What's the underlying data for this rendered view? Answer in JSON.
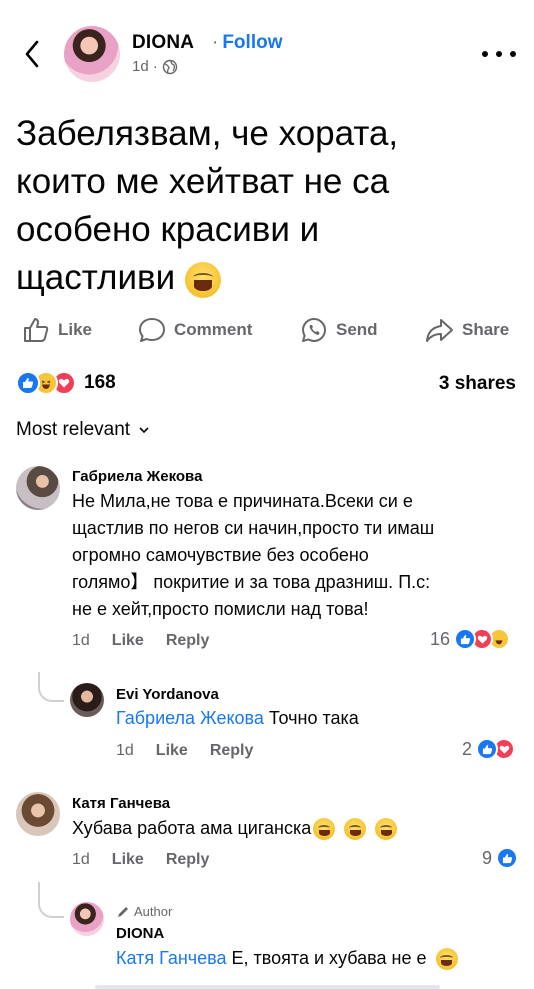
{
  "header": {
    "author": "DIONA",
    "separator": "·",
    "follow": "Follow",
    "time": "1d",
    "privacy_icon": "globe-icon"
  },
  "post": {
    "text_lines": [
      "Забелязвам, че хората,",
      "които ме хейтват не са",
      "особено красиви и",
      "щастливи"
    ],
    "emoji": "grinning-squinting-face"
  },
  "actions": {
    "like": "Like",
    "comment": "Comment",
    "send": "Send",
    "share": "Share"
  },
  "reactions": {
    "count": "168",
    "types": [
      "like",
      "haha",
      "love"
    ],
    "shares": "3 shares"
  },
  "sort": {
    "label": "Most relevant"
  },
  "comments": [
    {
      "name": "Габриела Жекова",
      "lines": [
        "Не Мила,не това е причината.Всеки си е",
        "щастлив по негов си начин,просто ти имаш",
        "огромно самочувствие без особено",
        "голямо】  покритие и за това дразниш. П.с:",
        "не е хейт,просто помисли над това!"
      ],
      "time": "1d",
      "like": "Like",
      "reply": "Reply",
      "reaction_count": "16",
      "reaction_types": [
        "like",
        "love",
        "haha"
      ]
    },
    {
      "name": "Evi Yordanova",
      "mention": "Габриела Жекова",
      "text": " Точно така",
      "time": "1d",
      "like": "Like",
      "reply": "Reply",
      "reaction_count": "2",
      "reaction_types": [
        "like",
        "love"
      ]
    },
    {
      "name": "Катя Ганчева",
      "text": "Хубава работа ама циганска",
      "time": "1d",
      "like": "Like",
      "reply": "Reply",
      "reaction_count": "9",
      "reaction_types": [
        "like"
      ]
    },
    {
      "badge": "Author",
      "name": "DIONA",
      "mention": "Катя Ганчева",
      "text": " Е, твоята и хубава не е"
    }
  ],
  "colors": {
    "accent": "#1877f2",
    "muted": "#65676b",
    "love": "#f33e58",
    "haha": "#f7c53a"
  }
}
